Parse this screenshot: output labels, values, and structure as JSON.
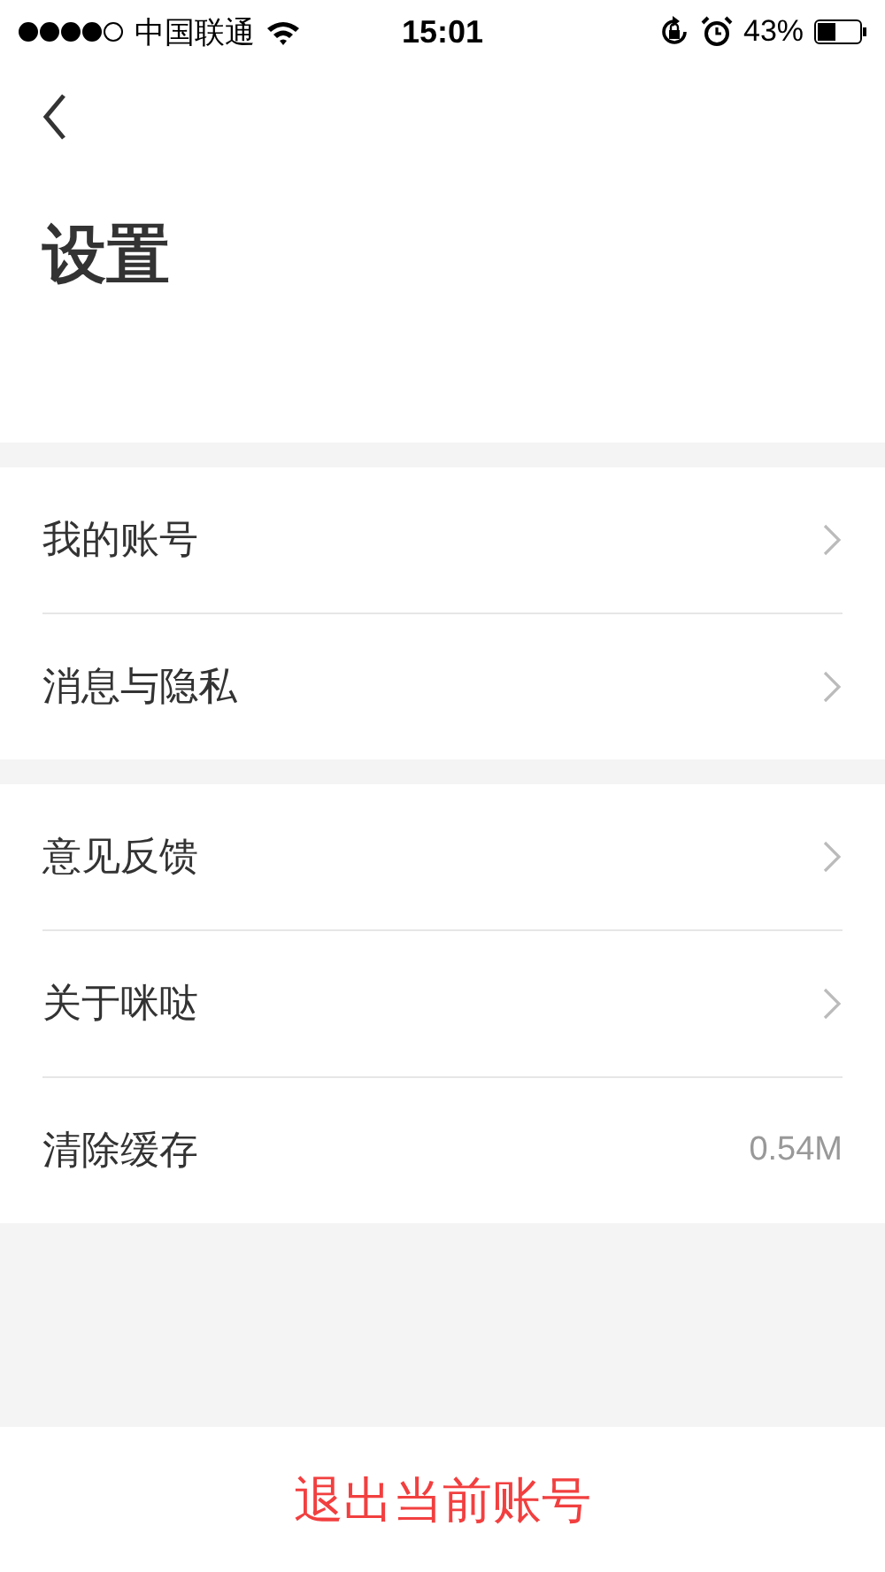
{
  "status_bar": {
    "carrier": "中国联通",
    "time": "15:01",
    "battery": "43%"
  },
  "header": {
    "title": "设置"
  },
  "groups": [
    {
      "rows": [
        {
          "kind": "link",
          "label": "我的账号"
        },
        {
          "kind": "link",
          "label": "消息与隐私"
        }
      ]
    },
    {
      "rows": [
        {
          "kind": "link",
          "label": "意见反馈"
        },
        {
          "kind": "link",
          "label": "关于咪哒"
        },
        {
          "kind": "value",
          "label": "清除缓存",
          "value": "0.54M"
        }
      ]
    }
  ],
  "logout_button": "退出当前账号"
}
